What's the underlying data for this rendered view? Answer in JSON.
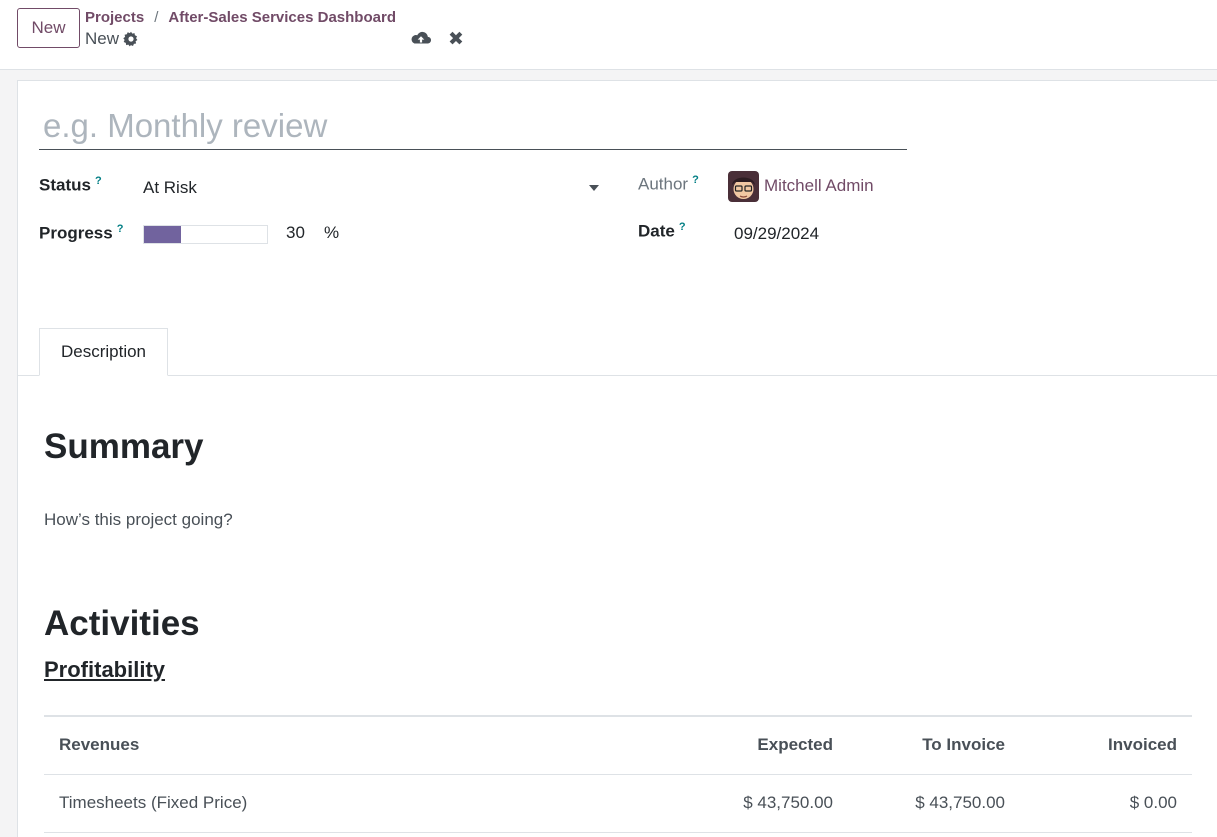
{
  "header": {
    "new_button": "New",
    "breadcrumb": [
      "Projects",
      "After-Sales Services Dashboard"
    ],
    "breadcrumb_separator": "/",
    "record_name": "New"
  },
  "form": {
    "name_placeholder": "e.g. Monthly review",
    "status_label": "Status",
    "status_value": "At Risk",
    "progress_label": "Progress",
    "progress_value": "30",
    "progress_fraction": 0.3,
    "progress_unit": "%",
    "author_label": "Author",
    "author_value": "Mitchell Admin",
    "date_label": "Date",
    "date_value": "09/29/2024",
    "help_marker": "?"
  },
  "tabs": [
    {
      "label": "Description"
    }
  ],
  "description": {
    "summary_heading": "Summary",
    "summary_text": "How’s this project going?",
    "activities_heading": "Activities",
    "profitability_heading": "Profitability"
  },
  "profitability_table": {
    "headers": [
      "Revenues",
      "Expected",
      "To Invoice",
      "Invoiced"
    ],
    "rows": [
      [
        "Timesheets (Fixed Price)",
        "$ 43,750.00",
        "$ 43,750.00",
        "$ 0.00"
      ]
    ]
  },
  "colors": {
    "brand": "#714b67",
    "progress": "#71639e",
    "help": "#017e84"
  }
}
